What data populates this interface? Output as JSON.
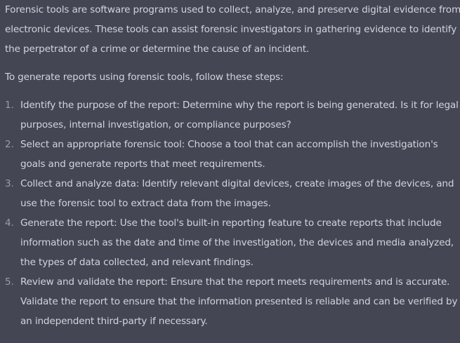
{
  "message": {
    "intro": "Forensic tools are software programs used to collect, analyze, and preserve digital evidence from electronic devices. These tools can assist forensic investigators in gathering evidence to identify the perpetrator of a crime or determine the cause of an incident.",
    "lead": "To generate reports using forensic tools, follow these steps:",
    "steps": [
      {
        "num": "1.",
        "text": "Identify the purpose of the report: Determine why the report is being generated. Is it for legal purposes, internal investigation, or compliance purposes?"
      },
      {
        "num": "2.",
        "text": "Select an appropriate forensic tool: Choose a tool that can accomplish the investigation's goals and generate reports that meet requirements."
      },
      {
        "num": "3.",
        "text": "Collect and analyze data: Identify relevant digital devices, create images of the devices, and use the forensic tool to extract data from the images."
      },
      {
        "num": "4.",
        "text": "Generate the report: Use the tool's built-in reporting feature to create reports that include information such as the date and time of the investigation, the devices and media analyzed, the types of data collected, and relevant findings."
      },
      {
        "num": "5.",
        "text": "Review and validate the report: Ensure that the report meets requirements and is accurate. Validate the report to ensure that the information presented is reliable and can be verified by an independent third-party if necessary."
      }
    ]
  },
  "colors": {
    "background": "#444654",
    "text": "#d1d5db",
    "list_number": "#9a9ca8"
  }
}
